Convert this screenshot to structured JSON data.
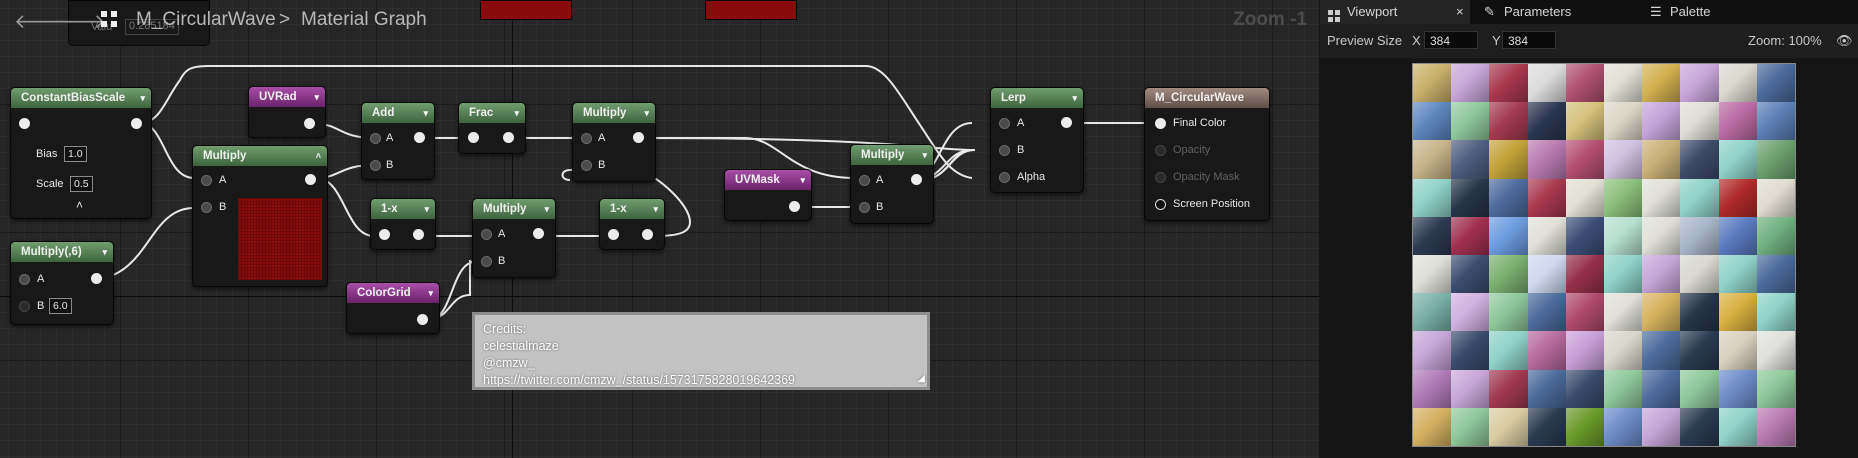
{
  "header": {
    "back_icon": "arrow-left-icon",
    "forward_icon": "arrow-right-icon",
    "asset_name": "M_CircularWave",
    "separator": ">",
    "section": "Material Graph",
    "zoom": "Zoom -1",
    "hidden_value_label": "Valu",
    "hidden_value": "0.285184"
  },
  "nodes": {
    "constant_bias_scale": {
      "title": "ConstantBiasScale",
      "bias_label": "Bias",
      "bias_value": "1.0",
      "scale_label": "Scale",
      "scale_value": "0.5"
    },
    "multiply_6": {
      "title": "Multiply(,6)",
      "a_label": "A",
      "b_label": "B",
      "b_value": "6.0"
    },
    "uvrad": {
      "title": "UVRad"
    },
    "multiply_preview": {
      "title": "Multiply",
      "a_label": "A",
      "b_label": "B"
    },
    "add": {
      "title": "Add",
      "a_label": "A",
      "b_label": "B"
    },
    "frac": {
      "title": "Frac"
    },
    "one_minus_1": {
      "title": "1-x"
    },
    "multiply_mid": {
      "title": "Multiply",
      "a_label": "A",
      "b_label": "B"
    },
    "multiply_top": {
      "title": "Multiply",
      "a_label": "A",
      "b_label": "B"
    },
    "one_minus_2": {
      "title": "1-x"
    },
    "colorgrid": {
      "title": "ColorGrid"
    },
    "uvmask": {
      "title": "UVMask"
    },
    "multiply_right": {
      "title": "Multiply",
      "a_label": "A",
      "b_label": "B"
    },
    "lerp": {
      "title": "Lerp",
      "a_label": "A",
      "b_label": "B",
      "alpha_label": "Alpha"
    },
    "result": {
      "title": "M_CircularWave",
      "final_color": "Final Color",
      "opacity": "Opacity",
      "opacity_mask": "Opacity Mask",
      "screen_position": "Screen Position"
    }
  },
  "comment": {
    "line1": "Credits:",
    "line2": "celestialmaze",
    "line3": "@cmzw_",
    "line4": "https://twitter.com/cmzw_/status/1573175828019642369"
  },
  "panel": {
    "tabs": [
      {
        "label": "Viewport",
        "icon": "viewport-icon",
        "close": "×"
      },
      {
        "label": "Parameters",
        "icon": "pencil-icon"
      },
      {
        "label": "Palette",
        "icon": "list-icon"
      }
    ],
    "preview_size_label": "Preview Size",
    "x_label": "X",
    "x_value": "384",
    "y_label": "Y",
    "y_value": "384",
    "zoom": "Zoom: 100%",
    "eye_icon": "eye-icon",
    "preview_colors": [
      "#c9b16a",
      "#c8a6d9",
      "#a8384e",
      "#dcdcdc",
      "#b05070",
      "#e0e0d6",
      "#d2b050",
      "#c8a6d9",
      "#dad8cf",
      "#4a6a9a",
      "#5d86c0",
      "#8fc89a",
      "#a33a4f",
      "#2a3550",
      "#d4c17a",
      "#ddd7c8",
      "#c3a4da",
      "#e0ddd6",
      "#b86aa2",
      "#5b7fb5",
      "#c8b48a",
      "#4e5e80",
      "#c3a23a",
      "#b87ab0",
      "#b54e72",
      "#cfc0e0",
      "#c9b078",
      "#3d4a68",
      "#8fd2c8",
      "#6ca06e",
      "#8fd2c8",
      "#263548",
      "#4c6a9c",
      "#a8384e",
      "#e2e0d4",
      "#8bbf7a",
      "#e0e0d8",
      "#8fd2c8",
      "#b02a2a",
      "#e0dcd0",
      "#2c3a50",
      "#a03050",
      "#6c9ce0",
      "#e0e0d8",
      "#3c4d76",
      "#b5e0cf",
      "#e0e0d8",
      "#a8b4c8",
      "#5a7abf",
      "#70b080",
      "#e0e0da",
      "#3c4c70",
      "#7ab070",
      "#cfd8f0",
      "#96304a",
      "#8fd2c8",
      "#c6a6d8",
      "#d8d8d0",
      "#8fd2c8",
      "#4a6a9a",
      "#7ab0a8",
      "#d0b0e0",
      "#8ec89a",
      "#4a6a9a",
      "#b04a6c",
      "#e0e0d8",
      "#d6b25e",
      "#263548",
      "#d8b040",
      "#8fd2c8",
      "#c6a6d8",
      "#3a4a6c",
      "#8fd2c8",
      "#b66aa0",
      "#c8a0d8",
      "#d8d6cc",
      "#4c6c9c",
      "#2a3a50",
      "#d8d0c0",
      "#e0e0dc",
      "#b07ab8",
      "#c8a6d8",
      "#a03850",
      "#4a6a9a",
      "#3a4a6c",
      "#8ec89a",
      "#4c6a9c",
      "#8ec89a",
      "#6c8cc8",
      "#8ec89a",
      "#d4b060",
      "#8ec89a",
      "#d8cca0",
      "#2a3a50",
      "#6a9a2a",
      "#6c8cc8",
      "#c6a6d8",
      "#2a3a50",
      "#8fd2c8",
      "#b87ab0"
    ]
  }
}
